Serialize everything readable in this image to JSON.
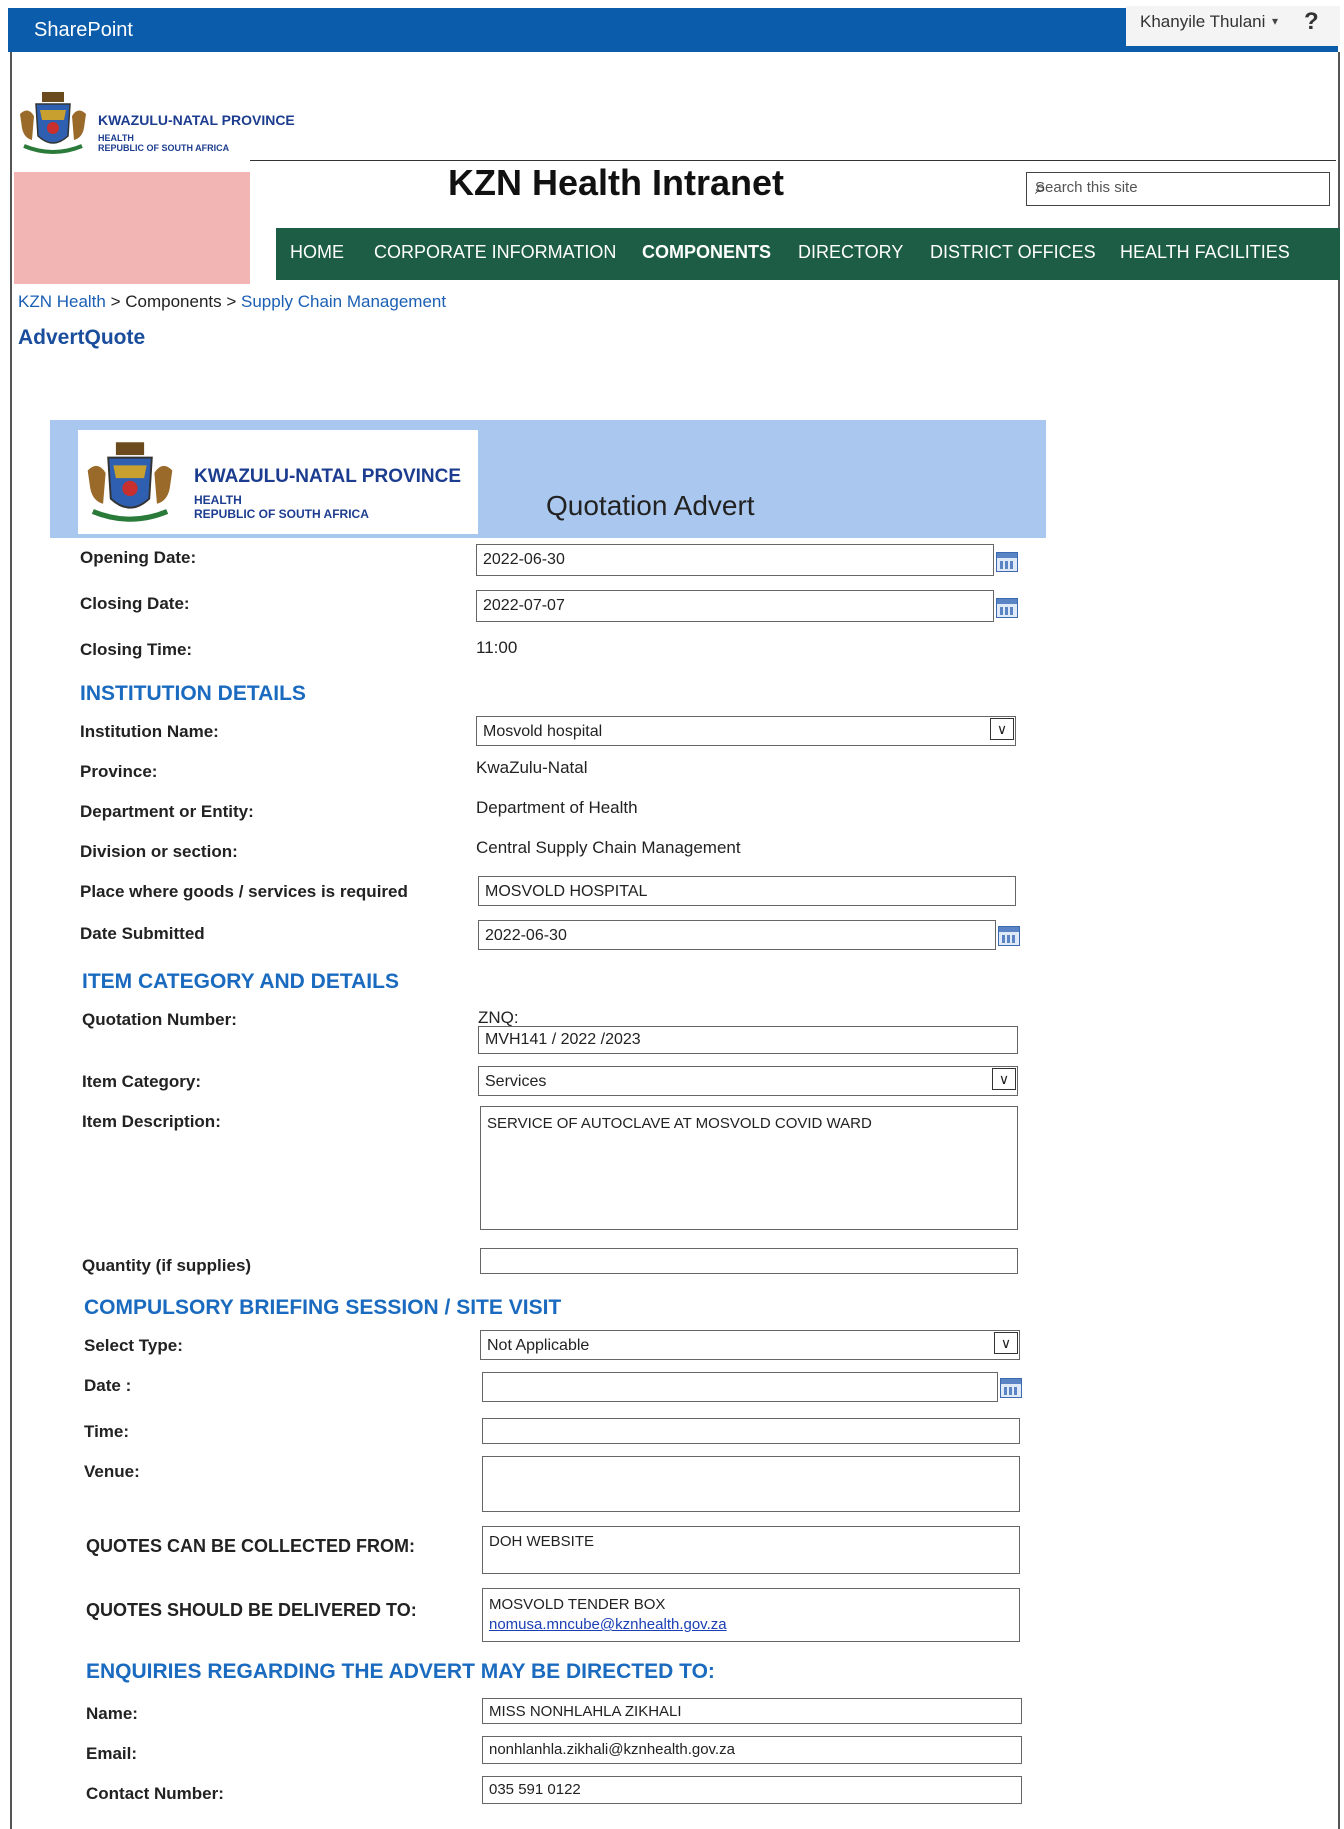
{
  "topbar": {
    "brand": "SharePoint",
    "user": "Khanyile Thulani",
    "user_arrow": "▾",
    "help": "?"
  },
  "header_logo": {
    "province": "KWAZULU-NATAL PROVINCE",
    "line1": "HEALTH",
    "line2": "REPUBLIC OF SOUTH AFRICA"
  },
  "site_title": "KZN Health Intranet",
  "search": {
    "placeholder": "Search this site"
  },
  "nav": [
    "HOME",
    "CORPORATE INFORMATION",
    "COMPONENTS",
    "DIRECTORY",
    "DISTRICT OFFICES",
    "HEALTH FACILITIES"
  ],
  "breadcrumb": {
    "root": "KZN Health",
    "sep": " > ",
    "mid": "Components",
    "last": "Supply Chain Management"
  },
  "page_title": "AdvertQuote",
  "banner": {
    "province": "KWAZULU-NATAL PROVINCE",
    "line1": "HEALTH",
    "line2": "REPUBLIC OF SOUTH AFRICA",
    "title": "Quotation Advert"
  },
  "form": {
    "opening_date_label": "Opening Date:",
    "opening_date": "2022-06-30",
    "closing_date_label": "Closing Date:",
    "closing_date": "2022-07-07",
    "closing_time_label": "Closing Time:",
    "closing_time": "11:00",
    "sec_institution": "INSTITUTION DETAILS",
    "institution_label": "Institution Name:",
    "institution": "Mosvold hospital",
    "province_label": "Province:",
    "province": "KwaZulu-Natal",
    "department_label": "Department or Entity:",
    "department": "Department of Health",
    "division_label": "Division or section:",
    "division": "Central Supply Chain Management",
    "place_label": "Place where goods /  services is required",
    "place": "MOSVOLD HOSPITAL",
    "date_submitted_label": "Date Submitted",
    "date_submitted": "2022-06-30",
    "sec_item": "ITEM CATEGORY AND DETAILS",
    "quotation_label": "Quotation Number:",
    "quotation_prefix": "ZNQ:",
    "quotation_number": "MVH141 / 2022 /2023",
    "category_label": "Item Category:",
    "category": "Services",
    "description_label": "Item Description:",
    "description": "SERVICE OF AUTOCLAVE AT MOSVOLD COVID WARD",
    "quantity_label": "Quantity (if supplies)",
    "quantity": "",
    "sec_briefing": "COMPULSORY BRIEFING SESSION / SITE VISIT",
    "select_type_label": "Select Type:",
    "select_type": "Not Applicable",
    "brief_date_label": "Date :",
    "brief_date": "",
    "time_label": "Time:",
    "time": "",
    "venue_label": "Venue:",
    "venue": "",
    "collected_label": "QUOTES CAN BE COLLECTED FROM:",
    "collected": "DOH WEBSITE",
    "delivered_label": "QUOTES SHOULD BE DELIVERED TO:",
    "delivered_line1": "MOSVOLD TENDER BOX",
    "delivered_email": "nomusa.mncube@kznhealth.gov.za",
    "sec_enquiries": "ENQUIRIES REGARDING THE ADVERT MAY BE DIRECTED TO:",
    "name_label": "Name:",
    "name": "MISS NONHLAHLA ZIKHALI",
    "email_label": "Email:",
    "email": "nonhlanhla.zikhali@kznhealth.gov.za",
    "contact_label": "Contact Number:",
    "contact": "035 591 0122"
  }
}
